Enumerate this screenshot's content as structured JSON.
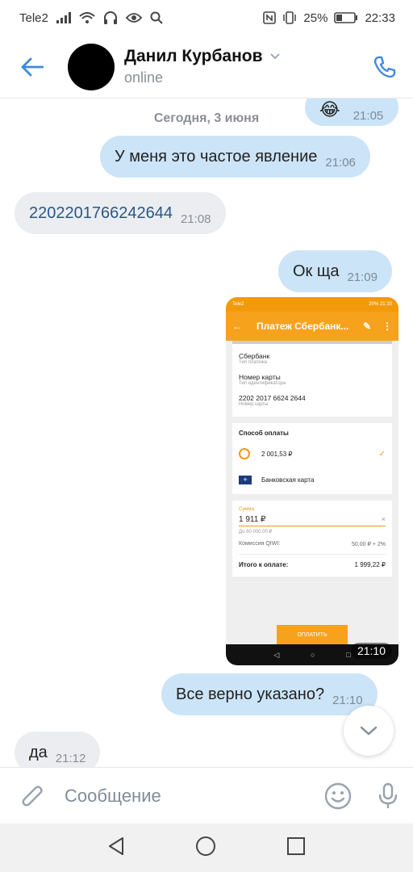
{
  "status_bar": {
    "carrier": "Tele2",
    "battery": "25%",
    "time": "22:33"
  },
  "header": {
    "contact_name": "Данил Курбанов",
    "contact_status": "online"
  },
  "chat": {
    "date_separator": "Сегодня, 3 июня",
    "messages": [
      {
        "direction": "out",
        "text": "😂",
        "time": "21:05"
      },
      {
        "direction": "out",
        "text": "У меня это частое явление",
        "time": "21:06"
      },
      {
        "direction": "in",
        "text": "2202201766242644",
        "time": "21:08"
      },
      {
        "direction": "out",
        "text": "Ок ща",
        "time": "21:09"
      },
      {
        "direction": "out",
        "type": "image",
        "time": "21:10"
      },
      {
        "direction": "out",
        "text": "Все верно указано?",
        "time": "21:10"
      },
      {
        "direction": "in",
        "text": "да",
        "time": "21:12"
      }
    ]
  },
  "photo": {
    "carrier": "Tele2",
    "status_right": "20% 21:10",
    "title": "Платеж Сбербанк...",
    "fields": [
      {
        "value": "Сбербанк",
        "label": "Тип платежа"
      },
      {
        "value": "Номер карты",
        "label": "Тип идентификатора"
      },
      {
        "value": "2202 2017 6624 2644",
        "label": "Номер карты"
      }
    ],
    "payment_method_title": "Способ оплаты",
    "qiwi_balance": "2 001,53 ₽",
    "bank_card": "Банковская карта",
    "amount_label": "Сумма",
    "amount_value": "1 911 ₽",
    "amount_limit": "До 60 000,00 ₽",
    "commission_label": "Комиссия QIWI:",
    "commission_value": "50,00 ₽ + 2%",
    "total_label": "Итого к оплате:",
    "total_value": "1 999,22 ₽",
    "pay_button": "ОПЛАТИТЬ"
  },
  "composer": {
    "placeholder": "Сообщение"
  },
  "colors": {
    "accent": "#3f8ae0",
    "outgoing_bubble": "#cce4f7",
    "incoming_bubble": "#ebedf0",
    "qiwi_orange": "#f7a21c"
  }
}
